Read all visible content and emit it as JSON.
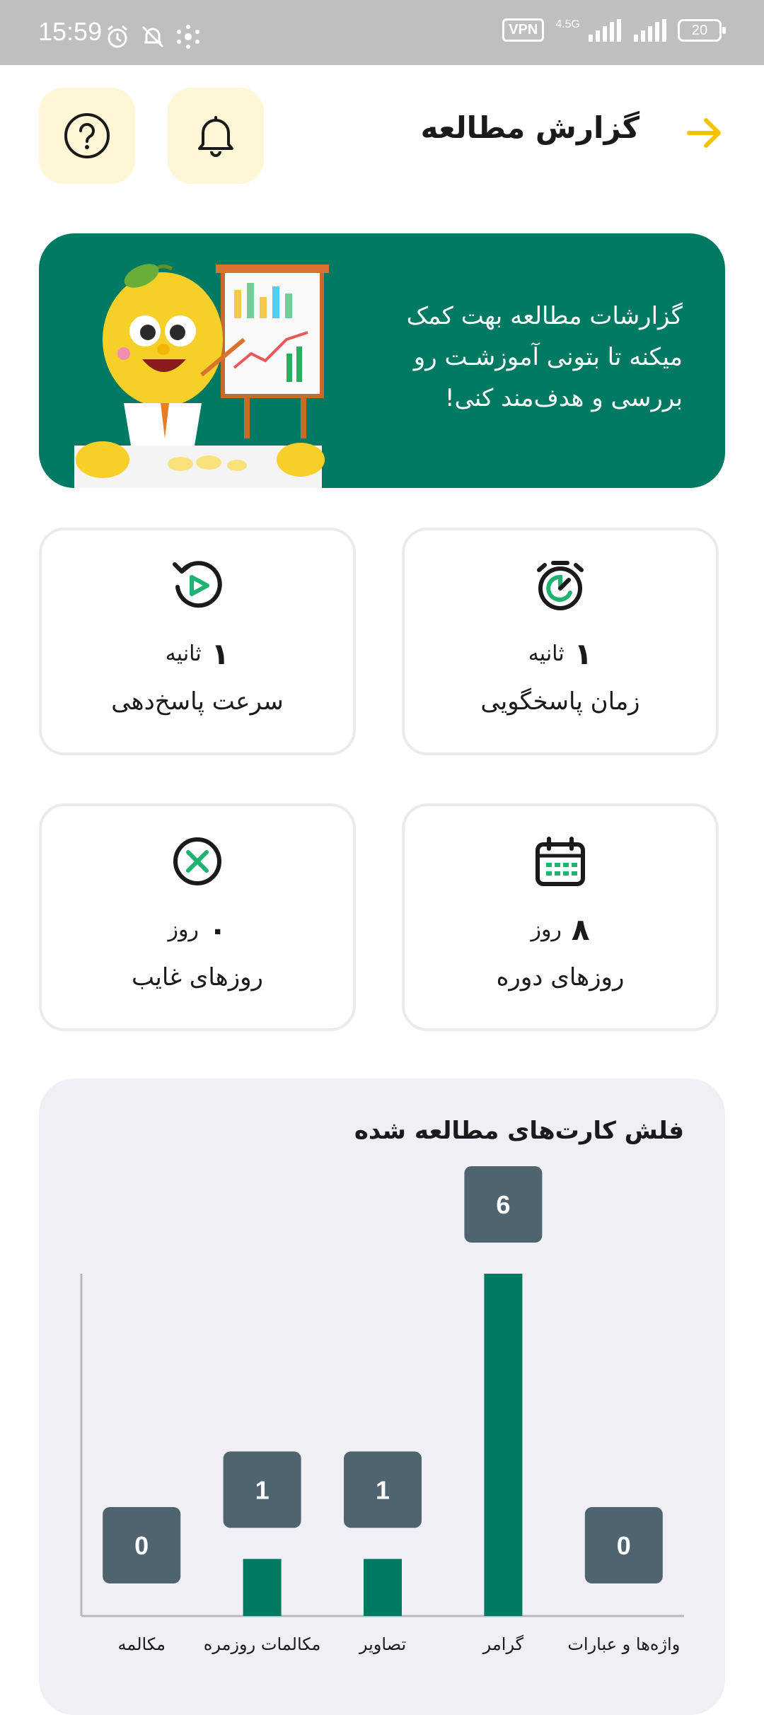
{
  "status_bar": {
    "time": "15:59",
    "vpn": "VPN",
    "network": "4.5G",
    "battery": "20"
  },
  "header": {
    "title": "گزارش مطالعه",
    "back_icon": "arrow-right-icon",
    "notification_icon": "bell-icon",
    "help_icon": "question-icon"
  },
  "banner": {
    "lines": [
      "گزارشات مطالعه بهت کمک",
      "میکنه تا بتونی آموزشـت رو",
      "بررسی و هدف‌مند کنی!"
    ]
  },
  "stats": [
    {
      "label": "زمان پاسخگویی",
      "value": "۱",
      "unit": "ثانیه",
      "icon": "stopwatch-icon"
    },
    {
      "label": "سرعت پاسخ‌دهی",
      "value": "۱",
      "unit": "ثانیه",
      "icon": "replay-icon"
    },
    {
      "label": "روزهای دوره",
      "value": "۸",
      "unit": "روز",
      "icon": "calendar-icon"
    },
    {
      "label": "روزهای غایب",
      "value": "۰",
      "unit": "روز",
      "icon": "cancel-icon"
    }
  ],
  "chart_data": {
    "type": "bar",
    "title": "فلش کارت‌های مطالعه شده",
    "categories": [
      "واژه‌ها و عبارات",
      "گرامر",
      "تصاویر",
      "مکالمات روزمره",
      "مکالمه"
    ],
    "values": [
      0,
      6,
      1,
      1,
      0
    ],
    "ylim": [
      0,
      6
    ],
    "colors": {
      "bar": "#017a63",
      "label_box": "#506470"
    }
  },
  "colors": {
    "primary": "#017a63",
    "accent_yellow": "#f5c200",
    "icon_button_bg": "#fef6d4"
  }
}
